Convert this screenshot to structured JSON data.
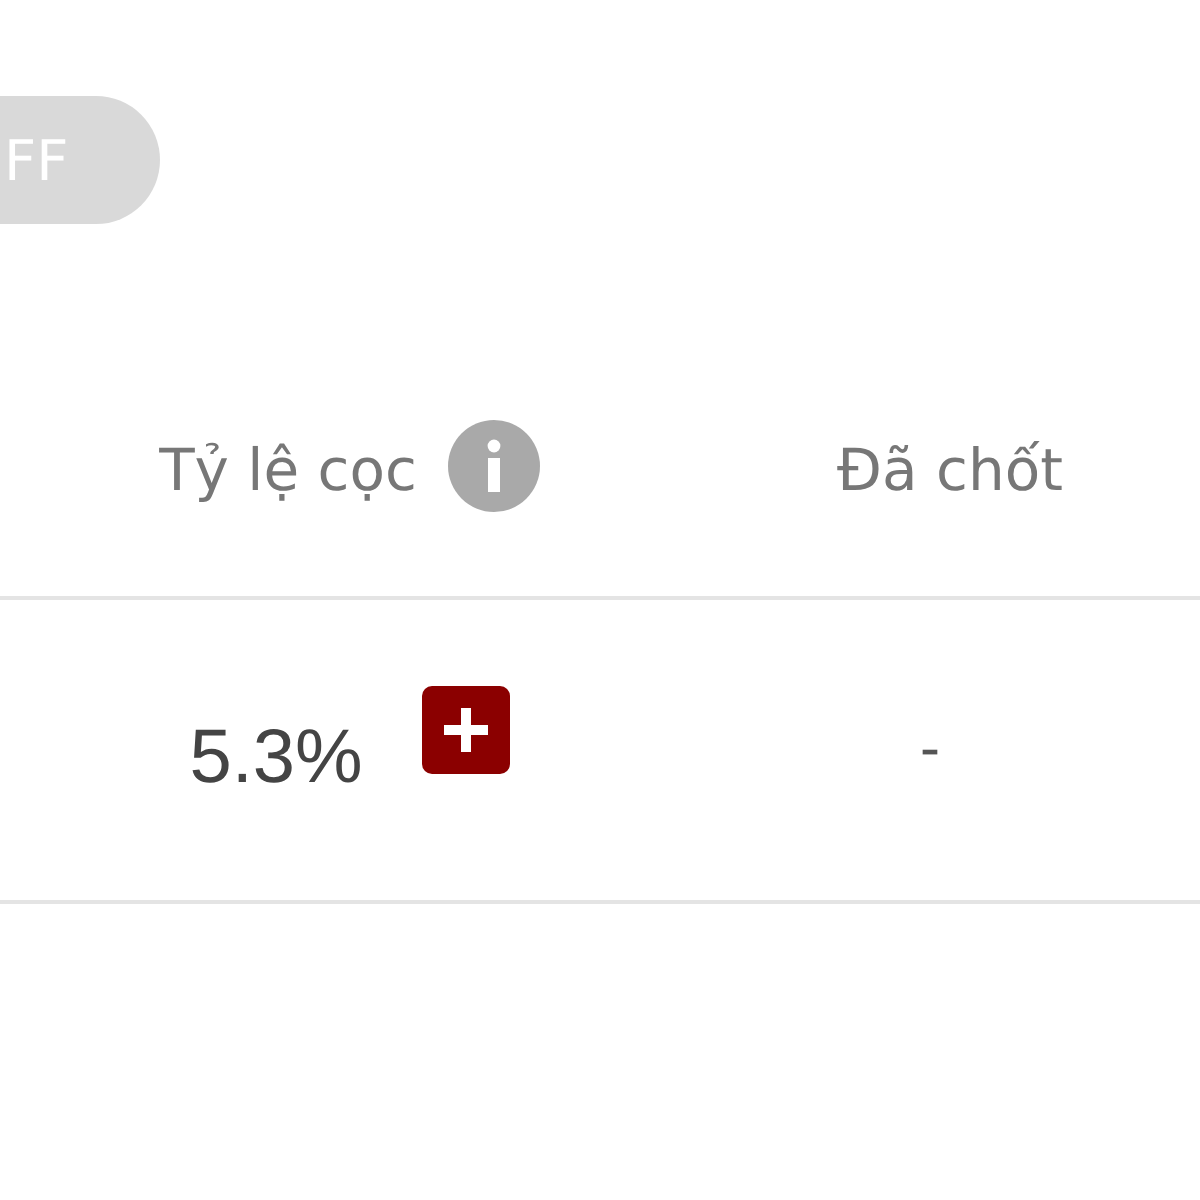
{
  "toggle": {
    "label": "FF",
    "on": false
  },
  "table": {
    "columns": [
      {
        "label": "Tỷ lệ cọc",
        "info": true
      },
      {
        "label": "Đã chốt",
        "info": false
      }
    ],
    "rows": [
      {
        "cells": [
          {
            "text": "5.3%",
            "add": true
          },
          {
            "text": "-",
            "add": false
          }
        ]
      }
    ]
  }
}
